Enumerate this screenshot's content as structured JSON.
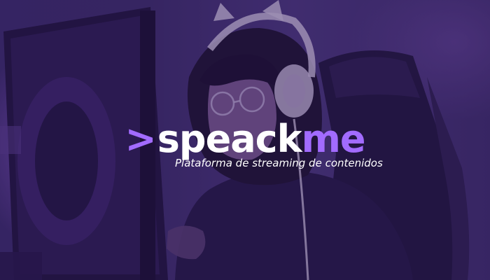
{
  "brand": {
    "chevron": ">",
    "name_main": "speack",
    "name_accent": "me",
    "tagline": "Plataforma de streaming de contenidos"
  },
  "colors": {
    "accent": "#a26bff",
    "text": "#ffffff",
    "overlay": "#2d195f"
  },
  "background": {
    "type": "photo"
  }
}
